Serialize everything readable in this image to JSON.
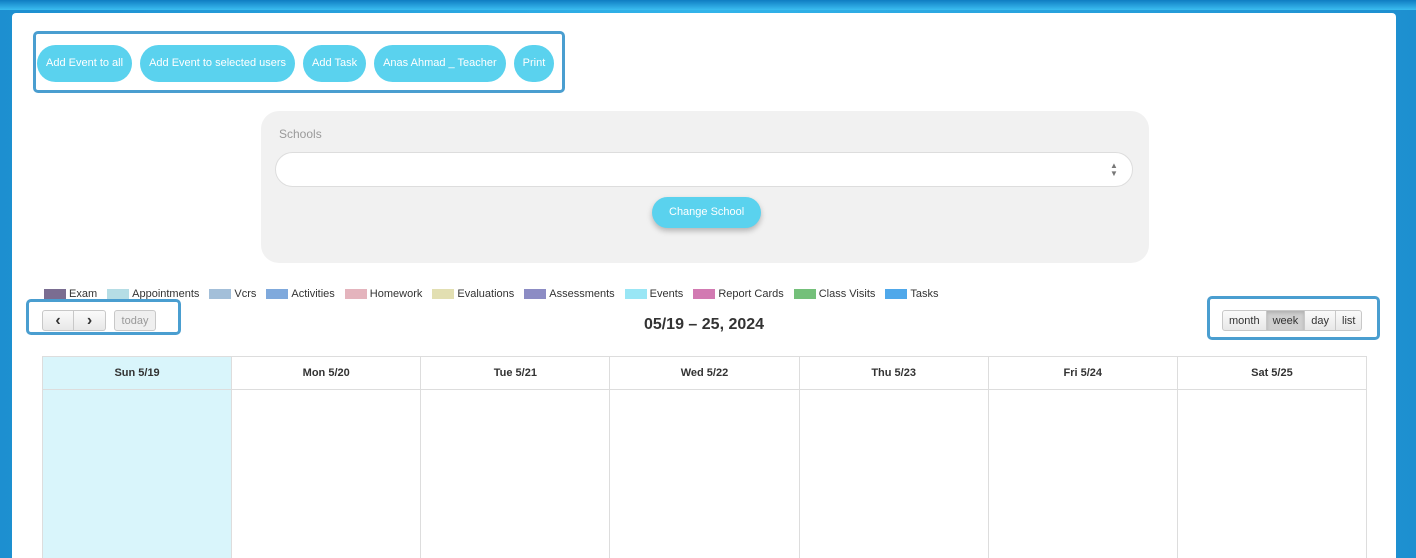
{
  "toolbar": {
    "buttons": [
      "Add Event to all",
      "Add Event to selected users",
      "Add Task",
      "Anas Ahmad _ Teacher",
      "Print"
    ]
  },
  "schools": {
    "label": "Schools",
    "selected_value": "",
    "change_button": "Change School"
  },
  "legend": [
    {
      "label": "Exam",
      "color": "#7a6d91"
    },
    {
      "label": "Appointments",
      "color": "#b5dde5"
    },
    {
      "label": "Vcrs",
      "color": "#a3bfd9"
    },
    {
      "label": "Activities",
      "color": "#7fa9dc"
    },
    {
      "label": "Homework",
      "color": "#e4b4bd"
    },
    {
      "label": "Evaluations",
      "color": "#e2dfb2"
    },
    {
      "label": "Assessments",
      "color": "#8c8cc4"
    },
    {
      "label": "Events",
      "color": "#99e6f5"
    },
    {
      "label": "Report Cards",
      "color": "#d27ab2"
    },
    {
      "label": "Class Visits",
      "color": "#74c07a"
    },
    {
      "label": "Tasks",
      "color": "#4fa8ea"
    }
  ],
  "calendar": {
    "title": "05/19 – 25, 2024",
    "prev_icon": "chevron-left-icon",
    "next_icon": "chevron-right-icon",
    "prev_glyph": "‹",
    "next_glyph": "›",
    "today_label": "today",
    "views": [
      "month",
      "week",
      "day",
      "list"
    ],
    "active_view": "week",
    "days": [
      "Sun 5/19",
      "Mon 5/20",
      "Tue 5/21",
      "Wed 5/22",
      "Thu 5/23",
      "Fri 5/24",
      "Sat 5/25"
    ],
    "today_index": 0
  },
  "colors": {
    "accent": "#5ad2ee",
    "today_bg": "#d9f5fb",
    "highlight_border": "#4a9ed0"
  }
}
